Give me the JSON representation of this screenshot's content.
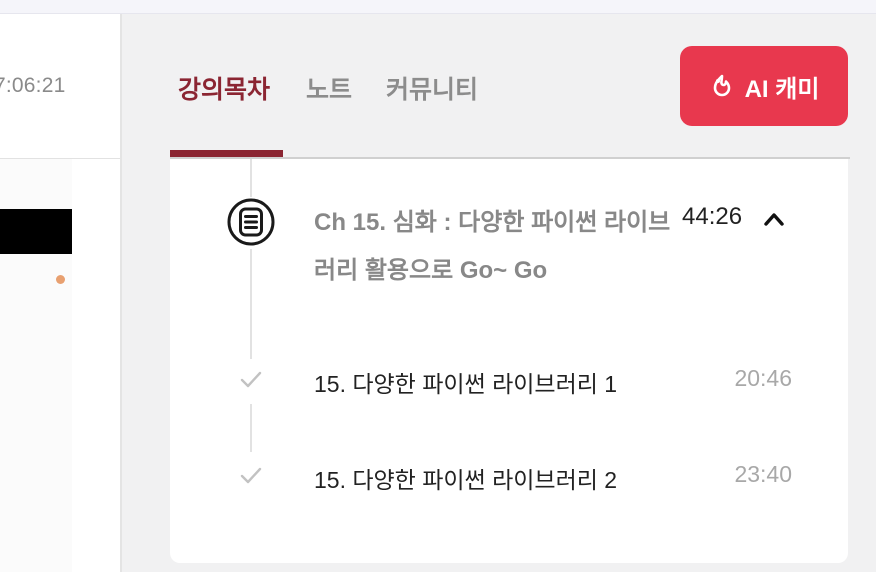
{
  "left_pane": {
    "time_text": "7:06:21"
  },
  "tabs": [
    {
      "label": "강의목차",
      "active": true
    },
    {
      "label": "노트",
      "active": false
    },
    {
      "label": "커뮤니티",
      "active": false
    }
  ],
  "ai_button": {
    "label": "AI 캐미",
    "icon": "flame-icon"
  },
  "chapter": {
    "title": "Ch 15. 심화 : 다양한 파이썬 라이브러리 활용으로 Go~ Go",
    "duration": "44:26",
    "expanded": true,
    "icon": "document-list-icon"
  },
  "lessons": [
    {
      "title": "15. 다양한 파이썬 라이브러리 1",
      "duration": "20:46",
      "completed_icon": "check-icon"
    },
    {
      "title": "15. 다양한 파이썬 라이브러리 2",
      "duration": "23:40",
      "completed_icon": "check-icon"
    }
  ],
  "colors": {
    "accent": "#8b2532",
    "ai_button": "#e8384e",
    "panel_bg": "#f1f1f2"
  }
}
